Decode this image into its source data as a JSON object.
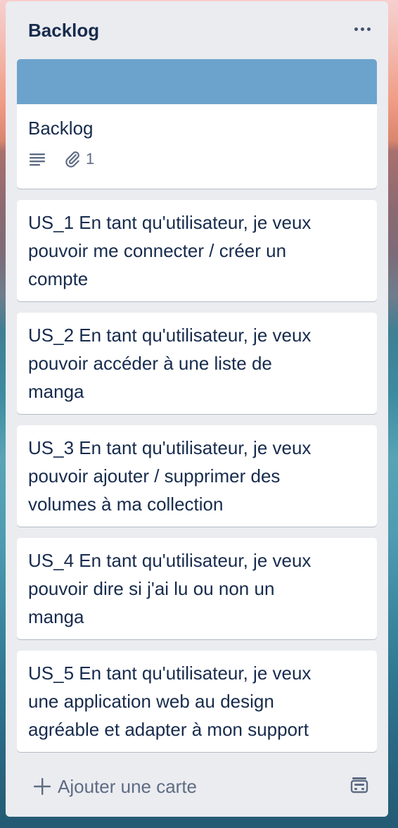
{
  "list": {
    "title": "Backlog",
    "menu_icon": "ellipsis-icon"
  },
  "cards": [
    {
      "title": "Backlog",
      "cover_color": "#6ca3cc",
      "badges": {
        "description_icon": "description-icon",
        "attachment_icon": "paperclip-icon",
        "attachment_count": "1"
      }
    },
    {
      "title": "US_1 En tant qu'utilisateur, je veux\npouvoir me connecter / créer un\ncompte"
    },
    {
      "title": "US_2 En tant qu'utilisateur, je veux\npouvoir accéder à une liste de\nmanga"
    },
    {
      "title": "US_3 En tant qu'utilisateur, je veux\npouvoir ajouter / supprimer des\nvolumes à ma collection"
    },
    {
      "title": "US_4 En tant qu'utilisateur, je veux\npouvoir dire si j'ai lu ou non un\nmanga"
    },
    {
      "title": "US_5 En tant qu'utilisateur, je veux\nune application web au design\nagréable et adapter à mon support"
    }
  ],
  "composer": {
    "label": "Ajouter une carte",
    "plus_icon": "plus-icon",
    "template_icon": "card-template-icon"
  }
}
